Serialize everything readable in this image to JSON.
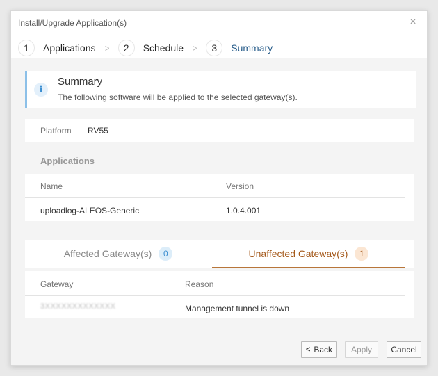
{
  "dialog": {
    "title": "Install/Upgrade Application(s)",
    "close_glyph": "×"
  },
  "steps": [
    {
      "num": "1",
      "label": "Applications"
    },
    {
      "num": "2",
      "label": "Schedule"
    },
    {
      "num": "3",
      "label": "Summary",
      "active": true
    }
  ],
  "summary": {
    "icon": "i",
    "title": "Summary",
    "text": "The following software will be applied to the selected gateway(s)."
  },
  "platform": {
    "label": "Platform",
    "value": "RV55"
  },
  "applications": {
    "title": "Applications",
    "columns": [
      "Name",
      "Version"
    ],
    "rows": [
      {
        "name": "uploadlog-ALEOS-Generic",
        "version": "1.0.4.001"
      }
    ]
  },
  "gateway_tabs": {
    "affected": {
      "label": "Affected Gateway(s)",
      "count": "0"
    },
    "unaffected": {
      "label": "Unaffected Gateway(s)",
      "count": "1"
    }
  },
  "gateways": {
    "columns": [
      "Gateway",
      "Reason"
    ],
    "rows": [
      {
        "gateway": "3XXXXXXXXXXXXX",
        "reason": "Management tunnel is down"
      }
    ]
  },
  "buttons": {
    "back": "Back",
    "apply": "Apply",
    "cancel": "Cancel"
  },
  "colors": {
    "accent": "#2b5f8c",
    "info": "#8cc0e8",
    "warning": "#a55a1c"
  }
}
